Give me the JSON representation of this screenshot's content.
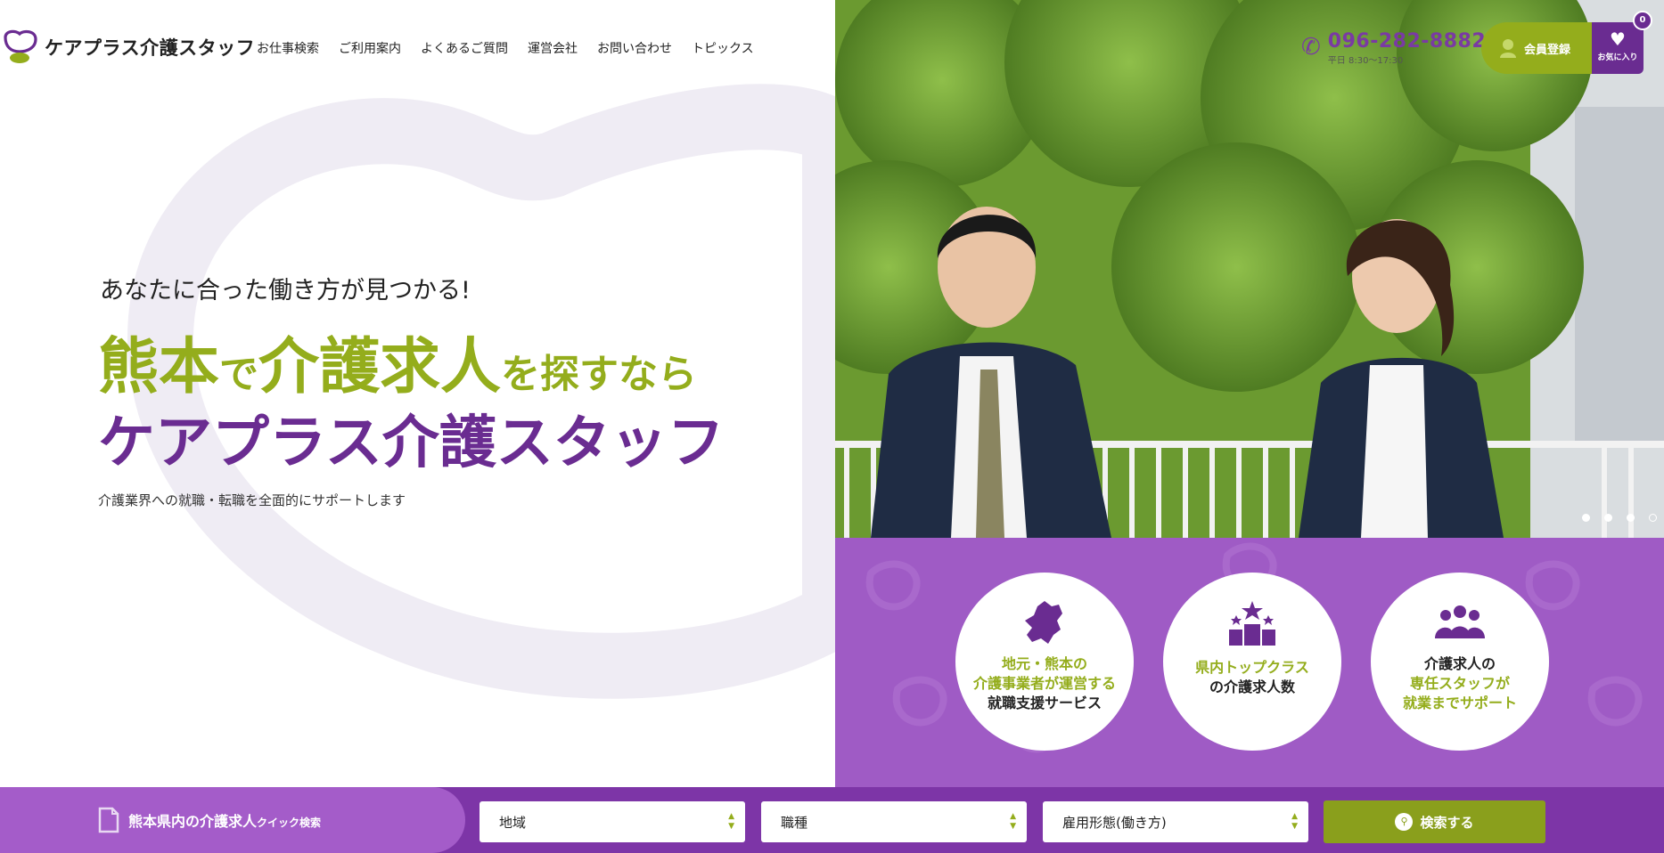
{
  "brand": {
    "name": "ケアプラス介護スタッフ",
    "green": "#94ad1c",
    "purple": "#6a2c91",
    "light_purple": "#9f5bc5"
  },
  "nav": [
    {
      "label": "お仕事検索"
    },
    {
      "label": "ご利用案内"
    },
    {
      "label": "よくあるご質問"
    },
    {
      "label": "運営会社"
    },
    {
      "label": "お問い合わせ"
    },
    {
      "label": "トピックス"
    }
  ],
  "contact": {
    "phone": "096-282-8882",
    "hours": "平日 8:30〜17:30",
    "icon": "phone-icon"
  },
  "member": {
    "label": "会員登録",
    "icon": "user-icon"
  },
  "favorites": {
    "label": "お気に入り",
    "count": "0",
    "icon": "heart-icon"
  },
  "hero": {
    "catch": "あなたに合った働き方が見つかる!",
    "line1": {
      "part1": "熊本",
      "part2": "で",
      "part3": "介護求人",
      "part4": "を探すなら"
    },
    "line2": "ケアプラス介護スタッフ",
    "sub": "介護業界への就職・転職を全面的にサポートします"
  },
  "slider": {
    "total": 4,
    "active": 3
  },
  "features": [
    {
      "icon": "kumamoto-map-icon",
      "lines": [
        "地元・熊本の",
        "介護事業者が運営する",
        "就職支援サービス"
      ]
    },
    {
      "icon": "ranking-podium-icon",
      "lines": [
        "県内トップクラス",
        "の介護求人数"
      ]
    },
    {
      "icon": "staff-group-icon",
      "lines": [
        "介護求人の",
        "専任スタッフが",
        "就業までサポート"
      ]
    }
  ],
  "quick_search": {
    "title": "熊本県内の介護求人",
    "title_small": "クイック検索",
    "area": "地域",
    "job": "職種",
    "employment": "雇用形態(働き方)",
    "button": "検索する"
  }
}
